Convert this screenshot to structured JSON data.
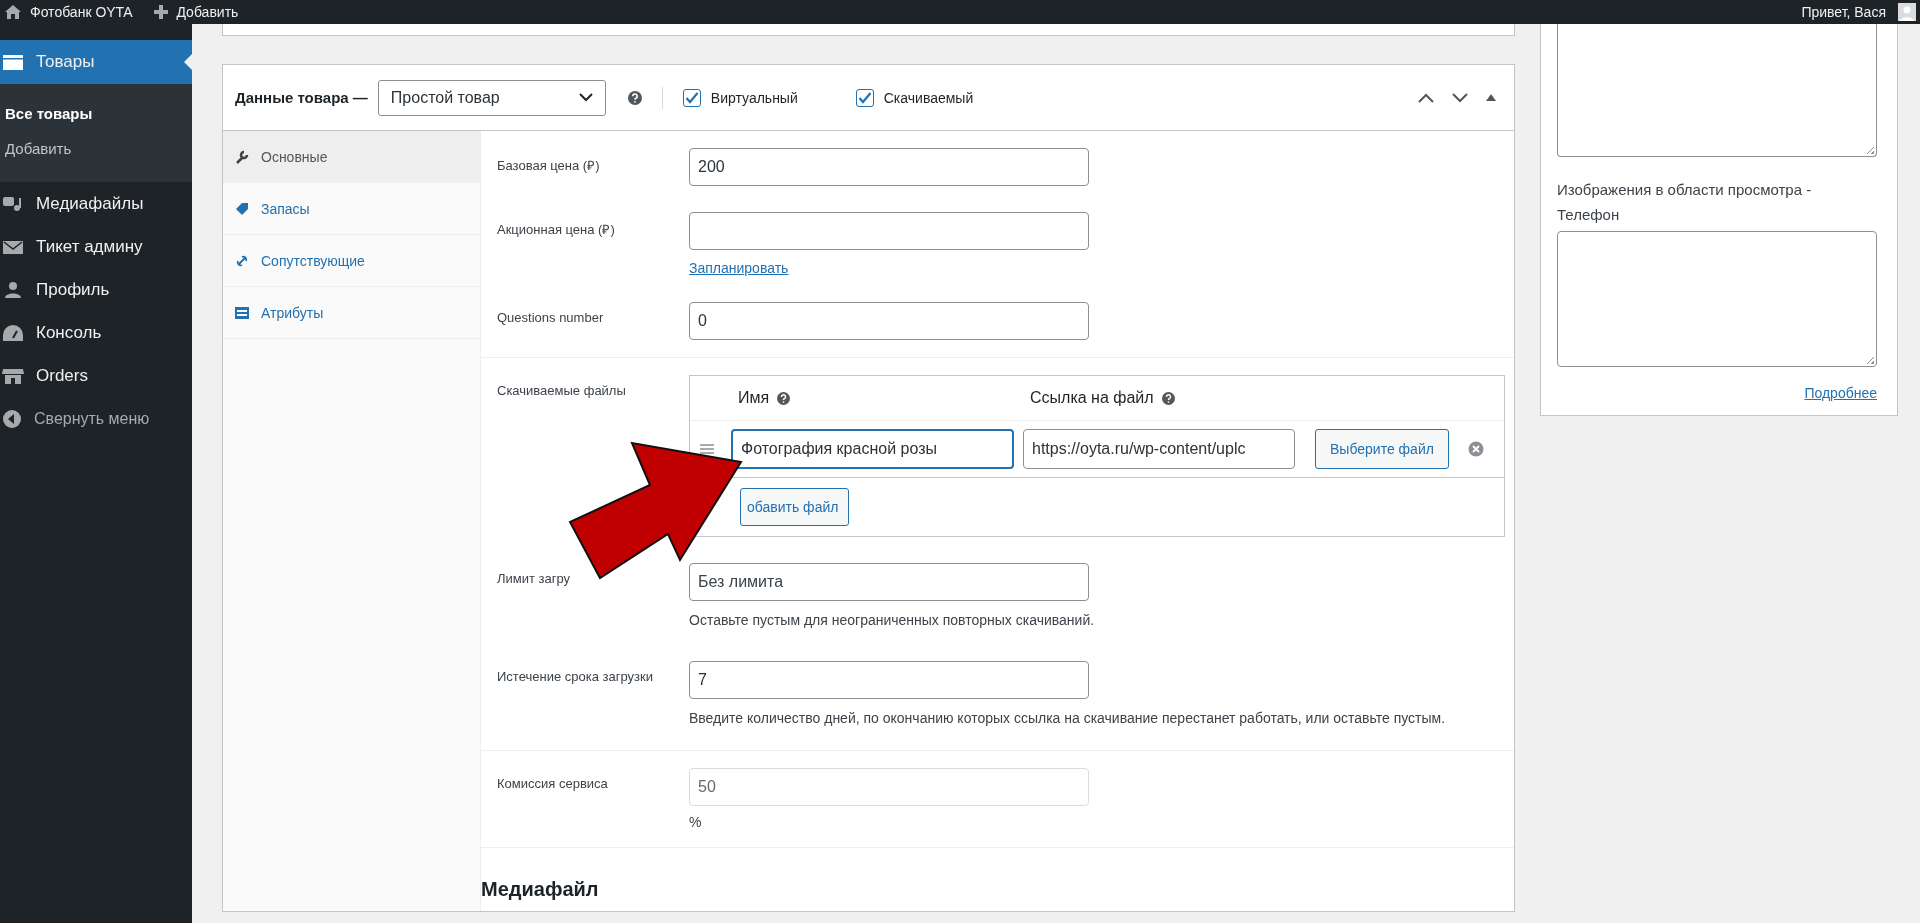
{
  "admin_bar": {
    "site": "Фотобанк OYTA",
    "add": "Добавить",
    "greeting": "Привет, Вася"
  },
  "sidebar": {
    "items": [
      {
        "label": "Товары",
        "selected": true,
        "children": [
          {
            "label": "Все товары",
            "selected": true
          },
          {
            "label": "Добавить",
            "selected": false
          }
        ]
      },
      {
        "label": "Медиафайлы",
        "selected": false
      },
      {
        "label": "Тикет админу",
        "selected": false
      },
      {
        "label": "Профиль",
        "selected": false
      },
      {
        "label": "Консоль",
        "selected": false
      },
      {
        "label": "Orders",
        "selected": false
      }
    ],
    "collapse": "Свернуть меню"
  },
  "product_data": {
    "title": "Данные товара —",
    "type": "Простой товар",
    "options": [
      {
        "label": "Виртуальный",
        "checked": true
      },
      {
        "label": "Скачиваемый",
        "checked": true
      }
    ],
    "tabs": [
      {
        "label": "Основные",
        "selected": true
      },
      {
        "label": "Запасы",
        "selected": false
      },
      {
        "label": "Сопутствующие",
        "selected": false
      },
      {
        "label": "Атрибуты",
        "selected": false
      }
    ],
    "sections": [
      [
        {
          "kind": "input",
          "label": "Базовая цена (₽)",
          "value": "200",
          "disabled": false
        },
        {
          "kind": "input",
          "label": "Акционная цена (₽)",
          "link": "Запланировать",
          "disabled": false
        },
        {
          "kind": "input",
          "label": "Questions number",
          "value": "0",
          "disabled": false
        }
      ],
      [
        {
          "kind": "downloads",
          "label": "Скачиваемые файлы",
          "columns": [
            "Имя",
            "Ссылка на файл"
          ],
          "files": [
            {
              "name": "Фотография красной розы",
              "url": "https://oyta.ru/wp-content/uplc",
              "button": "Выберите файл"
            }
          ],
          "add_button": "обавить файл"
        },
        {
          "kind": "input",
          "label": "Лимит загру",
          "placeholder": "Без лимита",
          "hint": "Оставьте пустым для неограниченных повторных скачиваний.",
          "disabled": false
        },
        {
          "kind": "input",
          "label": "Истечение срока загрузки",
          "value": "7",
          "hint": "Введите количество дней, по окончанию которых ссылка на скачивание перестанет работать, или оставьте пустым.",
          "disabled": false
        }
      ],
      [
        {
          "kind": "input",
          "label": "Комиссия сервиса",
          "value": "50",
          "suffix": "%",
          "disabled": true
        }
      ]
    ],
    "heading": "Медиафайл"
  },
  "side_box": {
    "label": "Изображения в области просмотра - Телефон",
    "link": "Подробнее"
  }
}
